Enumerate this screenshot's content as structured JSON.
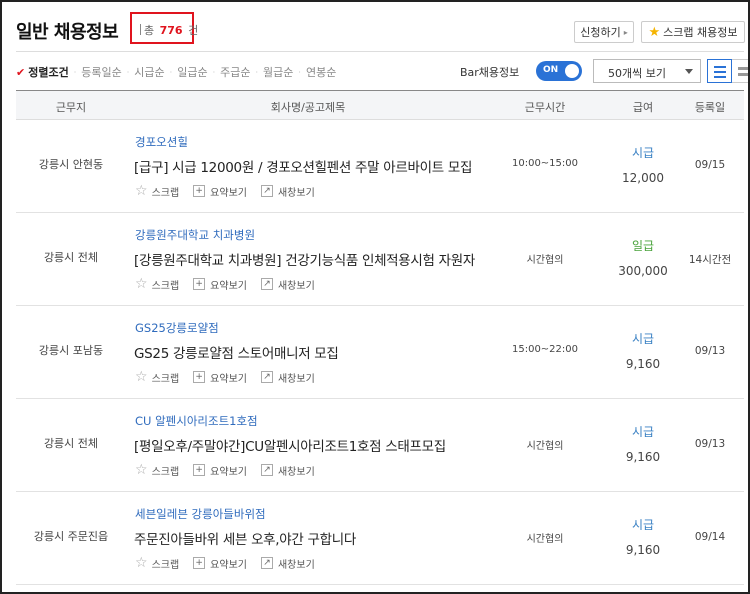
{
  "header": {
    "title": "일반 채용정보",
    "count_prefix": "총",
    "count_value": "776",
    "count_suffix": "건",
    "apply_button": "신청하기",
    "scrap_button": "스크랩 채용정보"
  },
  "sort": {
    "items": [
      {
        "label": "정렬조건",
        "active": true
      },
      {
        "label": "등록일순",
        "active": false
      },
      {
        "label": "시급순",
        "active": false
      },
      {
        "label": "일급순",
        "active": false
      },
      {
        "label": "주급순",
        "active": false
      },
      {
        "label": "월급순",
        "active": false
      },
      {
        "label": "연봉순",
        "active": false
      }
    ],
    "bar_label": "Bar채용정보",
    "toggle_label": "ON",
    "page_size": "50개씩 보기"
  },
  "table": {
    "headers": [
      "근무지",
      "회사명/공고제목",
      "근무시간",
      "급여",
      "등록일"
    ],
    "action_labels": {
      "scrap": "스크랩",
      "summary": "요약보기",
      "new_window": "새창보기"
    },
    "rows": [
      {
        "location": "강릉시 안현동",
        "company": "경포오션힐",
        "title": "[급구] 시급 12000원 / 경포오션힐펜션 주말 아르바이트 모집",
        "hours": "10:00~15:00",
        "pay_type": "시급",
        "pay_color": "#3b82c4",
        "pay": "12,000",
        "date": "09/15"
      },
      {
        "location": "강릉시 전체",
        "company": "강릉원주대학교 치과병원",
        "title": "[강릉원주대학교 치과병원] 건강기능식품 인체적용시험 자원자",
        "hours": "시간협의",
        "pay_type": "일급",
        "pay_color": "#4aa33c",
        "pay": "300,000",
        "date": "14시간전"
      },
      {
        "location": "강릉시 포남동",
        "company": "GS25강릉로얄점",
        "title": "GS25 강릉로얄점 스토어매니저 모집",
        "hours": "15:00~22:00",
        "pay_type": "시급",
        "pay_color": "#3b82c4",
        "pay": "9,160",
        "date": "09/13"
      },
      {
        "location": "강릉시 전체",
        "company": "CU 알펜시아리조트1호점",
        "title": "[평일오후/주말야간]CU알펜시아리조트1호점 스태프모집",
        "hours": "시간협의",
        "pay_type": "시급",
        "pay_color": "#3b82c4",
        "pay": "9,160",
        "date": "09/13"
      },
      {
        "location": "강릉시 주문진읍",
        "company": "세븐일레븐 강릉아들바위점",
        "title": "주문진아들바위 세븐 오후,야간 구합니다",
        "hours": "시간협의",
        "pay_type": "시급",
        "pay_color": "#3b82c4",
        "pay": "9,160",
        "date": "09/14"
      }
    ]
  }
}
